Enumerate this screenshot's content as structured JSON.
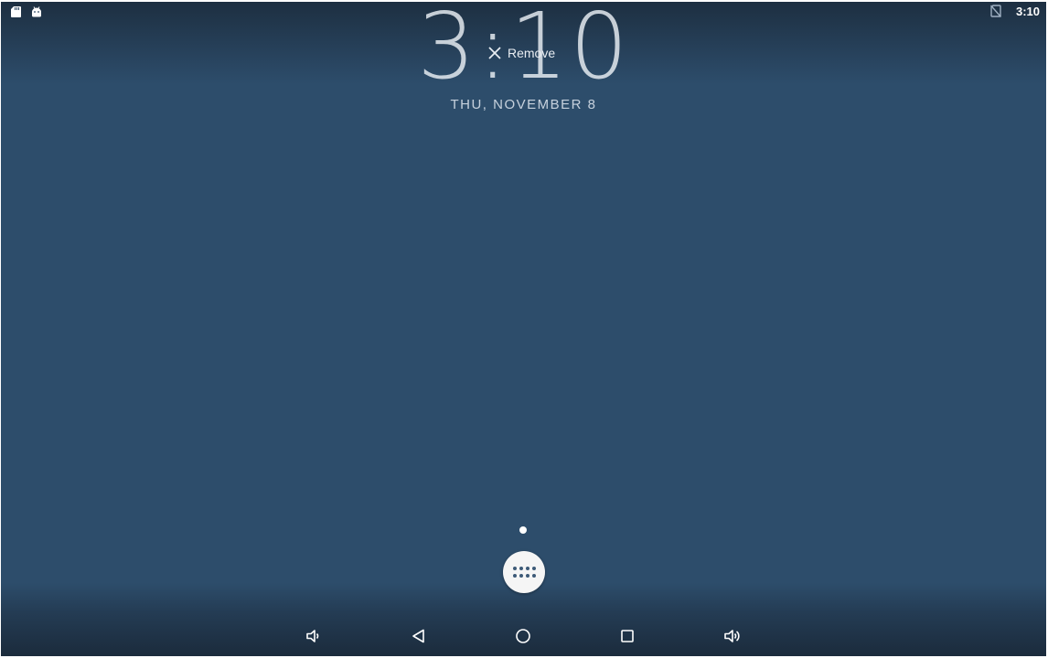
{
  "status_bar": {
    "time": "3:10",
    "left_icons": [
      "sd-card-icon",
      "android-debug-icon"
    ],
    "right_icons": [
      "no-sim-icon"
    ]
  },
  "clock": {
    "time": "3:10",
    "date": "THU, NOVEMBER 8"
  },
  "drop_target": {
    "label": "Remove",
    "icon": "close-icon"
  },
  "home": {
    "page_indicator_count": 1,
    "app_drawer_icon": "all-apps-icon"
  },
  "nav_bar": {
    "buttons": [
      "volume-down-icon",
      "back-icon",
      "home-icon",
      "recents-icon",
      "volume-up-icon"
    ]
  },
  "colors": {
    "wallpaper": "#2d4d6b",
    "text": "#ffffff"
  }
}
